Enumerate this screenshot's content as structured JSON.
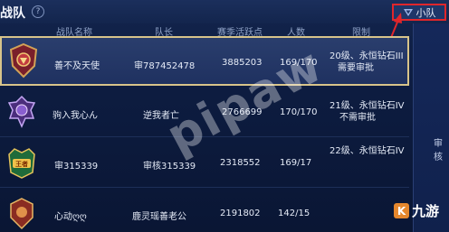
{
  "header": {
    "title": "战队",
    "help_glyph": "?",
    "team_tab_label": "小队"
  },
  "columns": [
    "战队名称",
    "队长",
    "赛季活跃点",
    "人数",
    "限制"
  ],
  "rows": [
    {
      "name": "善不及天使",
      "leader": "审787452478",
      "points": "3885203",
      "members": "169/170",
      "limit_line1": "20级、永恒钻石III",
      "limit_line2": "需要审批",
      "selected": true
    },
    {
      "name": "驹入我心ん",
      "leader": "逆我者亡",
      "points": "2766699",
      "members": "170/170",
      "limit_line1": "21级、永恒钻石IV",
      "limit_line2": "不需审批",
      "selected": false
    },
    {
      "name": "审315339",
      "leader": "审核315339",
      "points": "2318552",
      "members": "169/17",
      "limit_line1": "22级、永恒钻石IV",
      "limit_line2": "",
      "selected": false
    },
    {
      "name": "心动ღღ",
      "leader": "鹿灵瑶善老公",
      "points": "2191802",
      "members": "142/15",
      "limit_line1": "",
      "limit_line2": "",
      "selected": false
    }
  ],
  "side_panel": {
    "audit_text": "审核"
  },
  "watermark": "pipaw",
  "logo": {
    "glyph": "K",
    "text": "九游"
  },
  "colors": {
    "accent_red": "#e0262b",
    "selected_border": "#d8c48a",
    "bg": "#0c1a3a"
  }
}
